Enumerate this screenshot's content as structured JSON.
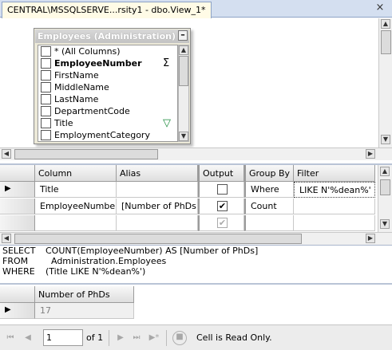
{
  "tab": {
    "title": "CENTRAL\\MSSQLSERVE...rsity1 - dbo.View_1*",
    "close": "×"
  },
  "diagram": {
    "table_title": "Employees (Administration)",
    "minimize": "–",
    "columns": [
      {
        "label": "* (All Columns)",
        "bold": false,
        "checked": false,
        "icon": ""
      },
      {
        "label": "EmployeeNumber",
        "bold": true,
        "checked": false,
        "icon": "sigma-icon",
        "icon_glyph": "Σ"
      },
      {
        "label": "FirstName",
        "bold": false,
        "checked": false,
        "icon": ""
      },
      {
        "label": "MiddleName",
        "bold": false,
        "checked": false,
        "icon": ""
      },
      {
        "label": "LastName",
        "bold": false,
        "checked": false,
        "icon": ""
      },
      {
        "label": "DepartmentCode",
        "bold": false,
        "checked": false,
        "icon": ""
      },
      {
        "label": "Title",
        "bold": false,
        "checked": false,
        "icon": "filter-icon",
        "icon_glyph": "▽"
      },
      {
        "label": "EmploymentCategory",
        "bold": false,
        "checked": false,
        "icon": ""
      }
    ]
  },
  "criteria": {
    "headers": {
      "column": "Column",
      "alias": "Alias",
      "output": "Output",
      "group_by": "Group By",
      "filter": "Filter"
    },
    "rows": [
      {
        "column": "Title",
        "alias": "",
        "output": false,
        "group_by": "Where",
        "filter": "LIKE N'%dean%'"
      },
      {
        "column": "EmployeeNumber",
        "alias": "[Number of PhDs]",
        "output": true,
        "group_by": "Count",
        "filter": ""
      },
      {
        "column": "",
        "alias": "",
        "output": true,
        "group_by": "",
        "filter": ""
      }
    ]
  },
  "sql": {
    "select_kw": "SELECT",
    "select_text": "COUNT(EmployeeNumber) AS [Number of PhDs]",
    "from_kw": "FROM",
    "from_text": "  Administration.Employees",
    "where_kw": "WHERE",
    "where_text": "(Title LIKE N'%dean%')"
  },
  "results": {
    "header": "Number of PhDs",
    "value": "17"
  },
  "status": {
    "page": "1",
    "of": "of 1",
    "message": "Cell is Read Only."
  },
  "colors": {
    "accent": "#d4dff0",
    "title_bar": "#c3c3c3"
  }
}
